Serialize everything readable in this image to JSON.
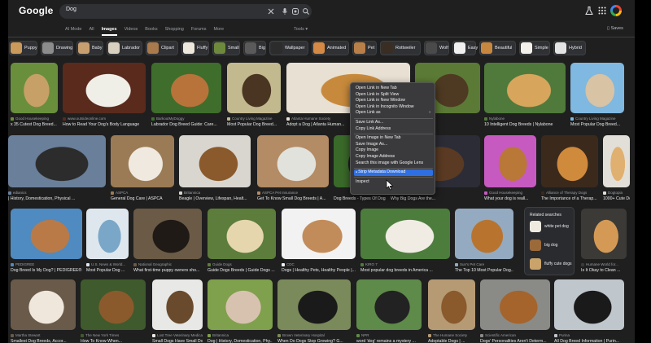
{
  "header": {
    "logo": "Google",
    "query": "Dog",
    "saves_label": "Saves"
  },
  "tabs": [
    {
      "label": "AI Mode"
    },
    {
      "label": "All"
    },
    {
      "label": "Images",
      "active": true
    },
    {
      "label": "Videos"
    },
    {
      "label": "Books"
    },
    {
      "label": "Shopping"
    },
    {
      "label": "Forums"
    },
    {
      "label": "More"
    }
  ],
  "tools_label": "Tools",
  "chips": [
    {
      "label": "Puppy",
      "color": "#c99a5a"
    },
    {
      "label": "Drawing",
      "color": "#8c8c8c"
    },
    {
      "label": "Baby",
      "color": "#c8a070"
    },
    {
      "label": "Labrador",
      "color": "#d9d0c0"
    },
    {
      "label": "Clipart",
      "color": "#a87a4c"
    },
    {
      "label": "Fluffy",
      "color": "#eee7dc"
    },
    {
      "label": "Small",
      "color": "#6d8a3c"
    },
    {
      "label": "Big",
      "color": "#5a5a5a"
    },
    {
      "label": "Wallpaper",
      "color": "#2c2c2c"
    },
    {
      "label": "Animated",
      "color": "#d48a44"
    },
    {
      "label": "Pet",
      "color": "#b87f48"
    },
    {
      "label": "Rottweiler",
      "color": "#3a2e24"
    },
    {
      "label": "Wolf",
      "color": "#4a4a4a"
    },
    {
      "label": "Easy",
      "color": "#f0f0f0"
    },
    {
      "label": "Beautiful",
      "color": "#c7873f"
    },
    {
      "label": "Simple",
      "color": "#f4f0ea"
    },
    {
      "label": "Hybrid",
      "color": "#e4e4e4"
    }
  ],
  "rows": [
    [
      {
        "source": "Good Housekeeping",
        "title": "x 35 Cutest Dog Breed...",
        "c1": "#6a8f3c",
        "c2": "#c7a067"
      },
      {
        "source": "www.outsideonline.com",
        "title": "How to Read Your Dog's Body Language",
        "c1": "#5a2a1c",
        "c2": "#efefe8"
      },
      {
        "source": "BarkoutMyDoggy",
        "title": "Labrador Dog Breed Guide: Care...",
        "c1": "#3f6d2c",
        "c2": "#b8733a"
      },
      {
        "source": "Country Living Magazine",
        "title": "Most Popular Dog Breed...",
        "c1": "#c2b98f",
        "c2": "#4a3522"
      },
      {
        "source": "Atlanta Humane Society",
        "title": "Adopt a Dog | Atlanta Human...",
        "c1": "#e8e0d2",
        "c2": "#c78a3c"
      },
      {
        "source": "",
        "title": "...",
        "c1": "#5b7a35",
        "c2": "#4e3a22"
      },
      {
        "source": "Nylabone",
        "title": "10 Intelligent Dog Breeds | Nylabone",
        "c1": "#4f7a3b",
        "c2": "#d8a55c"
      },
      {
        "source": "Country Living Magazine",
        "title": "Most Popular Dog Breed...",
        "c1": "#7fb8e0",
        "c2": "#d8c3a4"
      }
    ],
    [
      {
        "source": "edianics",
        "title": "| History, Domestication, Physical ...",
        "c1": "#6a7f9a",
        "c2": "#2c2c2c"
      },
      {
        "source": "ASPCA",
        "title": "General Dog Care | ASPCA",
        "c1": "#9b7b55",
        "c2": "#efe9e0"
      },
      {
        "source": "Britannica",
        "title": "Beagle | Overview, Lifespan, Healt...",
        "c1": "#d9d6d0",
        "c2": "#8a5a2c"
      },
      {
        "source": "ASPCA Pet Insurance",
        "title": "Get To Know Small Dog Breeds | A...",
        "c1": "#b38b64",
        "c2": "#e2e2dc"
      },
      {
        "source": "",
        "title": "Dog Breeds - Types Of Dogs - Am...",
        "c1": "#3a6a2a",
        "c2": "#1f1f1f"
      },
      {
        "source": "",
        "title": "Why Big Dogs Are the...",
        "c1": "#2c2c36",
        "c2": "#5a3a22"
      },
      {
        "source": "Good Housekeeping",
        "title": "What your dog is reall...",
        "c1": "#c75ac1",
        "c2": "#b97738"
      },
      {
        "source": "Alliance of Therapy Dogs",
        "title": "The Importance of a Therap...",
        "c1": "#3b2a1c",
        "c2": "#d08a3c"
      },
      {
        "source": "Dogtopia",
        "title": "1000+ Cute Dogs ...",
        "c1": "#e2dfd8",
        "c2": "#e0b070"
      }
    ],
    [
      {
        "source": "PEDIGREE",
        "title": "Dog Breed Is My Dog? | PEDIGREE®",
        "c1": "#4f8ac0",
        "c2": "#b97a48"
      },
      {
        "source": "U.S. News & World...",
        "title": "Most Popular Dog ...",
        "c1": "#dfe7ee",
        "c2": "#7aa7c8"
      },
      {
        "source": "National Geographic",
        "title": "What first-time puppy owners sho...",
        "c1": "#6b5a46",
        "c2": "#1f1a16"
      },
      {
        "source": "Guide Dogs",
        "title": "Guide Dogs Breeds | Guide Dogs ...",
        "c1": "#5c7d3b",
        "c2": "#e6d6ae"
      },
      {
        "source": "CDC",
        "title": "Dogs | Healthy Pets, Healthy People |...",
        "c1": "#f2f2f2",
        "c2": "#c28c5a"
      },
      {
        "source": "KIRO 7",
        "title": "Most popular dog breeds in America ...",
        "c1": "#4c7d3c",
        "c2": "#f0ece4"
      },
      {
        "source": "Sun's Pet Care",
        "title": "The Top 10 Most Popular Dog...",
        "c1": "#94aac0",
        "c2": "#b8742e"
      },
      {
        "source": "Humane World for...",
        "title": "Is It Okay to Clean ...",
        "c1": "#3b3a36",
        "c2": "#d49a55"
      }
    ],
    [
      {
        "source": "Martha Stewart",
        "title": "Smallest Dog Breeds, Accor...",
        "c1": "#6a5a4a",
        "c2": "#efe6dc"
      },
      {
        "source": "The New York Times",
        "title": "How To Know When...",
        "c1": "#3f5a2c",
        "c2": "#8a5a2c"
      },
      {
        "source": "Lost Tree Veterinary Medical Center",
        "title": "Small Dogs Have Small Dog Nee...",
        "c1": "#e8e8e6",
        "c2": "#6a4a2c"
      },
      {
        "source": "Britannica",
        "title": "Dog | History, Domestication, Phy...",
        "c1": "#7fa04c",
        "c2": "#d7c2b0"
      },
      {
        "source": "Brown Veterinary Hospital",
        "title": "When Do Dogs Stop Growing? G...",
        "c1": "#7a8a5a",
        "c2": "#1a1a1a"
      },
      {
        "source": "NPR",
        "title": "word 'dog' remains a mystery ...",
        "c1": "#5e8a4a",
        "c2": "#222222"
      },
      {
        "source": "The Humane Society",
        "title": "Adoptable Dogs | ...",
        "c1": "#b59a74",
        "c2": "#8a5a2c"
      },
      {
        "source": "Scientific American",
        "title": "Dogs' Personalities Aren't Determ...",
        "c1": "#8a8a86",
        "c2": "#a4642c"
      },
      {
        "source": "Purina",
        "title": "All Dog Breed Information | Purin...",
        "c1": "#bfc6cc",
        "c2": "#1a1a1a"
      }
    ]
  ],
  "related": {
    "heading": "Related searches",
    "items": [
      {
        "label": "white pet dog",
        "color": "#eeeae0"
      },
      {
        "label": "big dog",
        "color": "#9a6a3a"
      },
      {
        "label": "fluffy cute dogs",
        "color": "#c9a36a"
      }
    ]
  },
  "context_menu": {
    "items": [
      {
        "label": "Open Link in New Tab"
      },
      {
        "label": "Open Link in Split View"
      },
      {
        "label": "Open Link in New Window"
      },
      {
        "label": "Open Link in Incognito Window"
      },
      {
        "label": "Open Link as",
        "submenu": true
      },
      {
        "sep": true
      },
      {
        "label": "Save Link As..."
      },
      {
        "label": "Copy Link Address"
      },
      {
        "sep": true
      },
      {
        "label": "Open Image in New Tab"
      },
      {
        "label": "Save Image As..."
      },
      {
        "label": "Copy Image"
      },
      {
        "label": "Copy Image Address"
      },
      {
        "label": "Search this image with Google Lens"
      },
      {
        "sep": true
      },
      {
        "label": "Strip Metadata Download",
        "highlighted": true
      },
      {
        "sep": true
      },
      {
        "label": "Inspect"
      }
    ]
  }
}
